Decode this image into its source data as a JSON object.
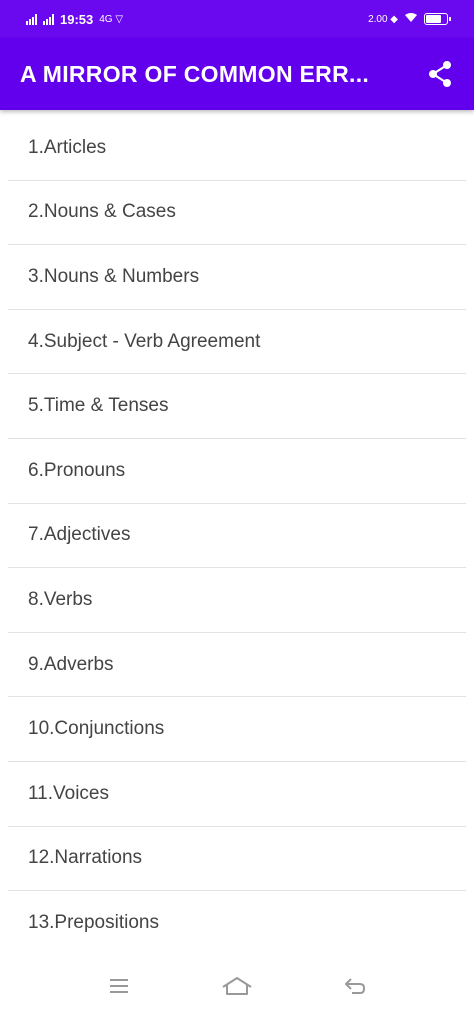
{
  "status_bar": {
    "time": "19:53",
    "left_extra": "4G ▽",
    "right_text": "2.00 ◆"
  },
  "app_bar": {
    "title": "A MIRROR OF COMMON ERR...",
    "share_icon": "share-icon",
    "background": "#6200ee"
  },
  "topics": [
    {
      "label": "1.Articles"
    },
    {
      "label": "2.Nouns & Cases"
    },
    {
      "label": "3.Nouns & Numbers"
    },
    {
      "label": "4.Subject - Verb Agreement"
    },
    {
      "label": "5.Time & Tenses"
    },
    {
      "label": "6.Pronouns"
    },
    {
      "label": "7.Adjectives"
    },
    {
      "label": "8.Verbs"
    },
    {
      "label": "9.Adverbs"
    },
    {
      "label": "10.Conjunctions"
    },
    {
      "label": "11.Voices"
    },
    {
      "label": "12.Narrations"
    },
    {
      "label": "13.Prepositions"
    }
  ],
  "nav_bar": {
    "menu_icon": "menu-icon",
    "home_icon": "home-icon",
    "back_icon": "back-icon"
  }
}
